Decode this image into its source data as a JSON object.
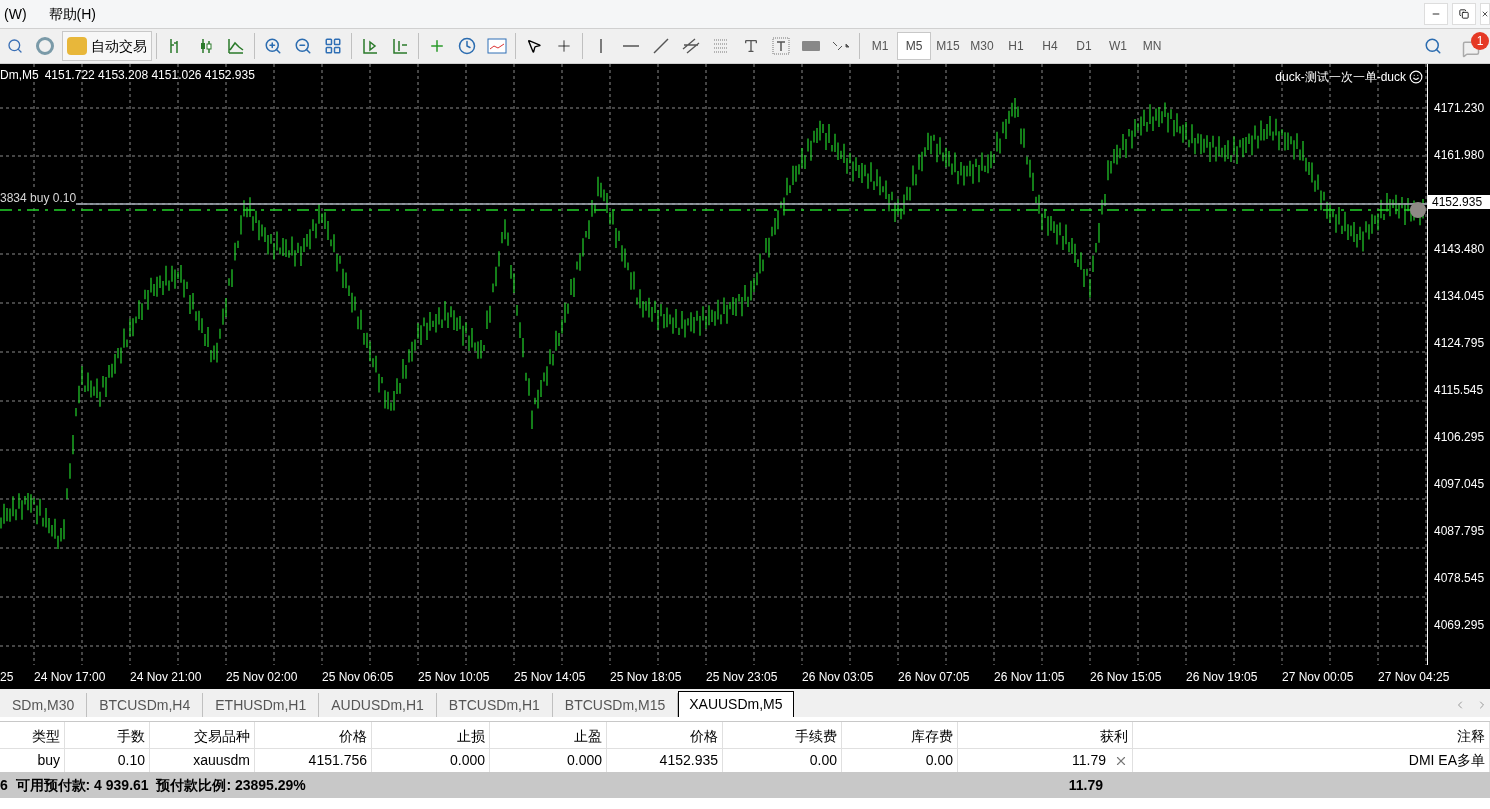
{
  "menu": [
    {
      "label": "(W)"
    },
    {
      "label": "帮助(H)"
    }
  ],
  "toolbar": {
    "auto_trading": "自动交易",
    "timeframes": [
      {
        "label": "M1",
        "selected": false
      },
      {
        "label": "M5",
        "selected": true
      },
      {
        "label": "M15",
        "selected": false
      },
      {
        "label": "M30",
        "selected": false
      },
      {
        "label": "H1",
        "selected": false
      },
      {
        "label": "H4",
        "selected": false
      },
      {
        "label": "D1",
        "selected": false
      },
      {
        "label": "W1",
        "selected": false
      },
      {
        "label": "MN",
        "selected": false
      }
    ],
    "notification_count": "1"
  },
  "chart": {
    "header_symbol": "Dm,M5",
    "header_prices": "4151.722 4153.208 4151.026 4152.935",
    "expert": "duck-测试一次一单-duck",
    "order_label": "3834 buy 0.10",
    "price_labels": [
      {
        "text": "4171.230",
        "kind": "tick"
      },
      {
        "text": "4161.980",
        "kind": "tick"
      },
      {
        "text": "4152.935",
        "kind": "current"
      },
      {
        "text": "4143.480",
        "kind": "tick"
      },
      {
        "text": "4134.045",
        "kind": "tick"
      },
      {
        "text": "4124.795",
        "kind": "tick"
      },
      {
        "text": "4115.545",
        "kind": "tick"
      },
      {
        "text": "4106.295",
        "kind": "tick"
      },
      {
        "text": "4097.045",
        "kind": "tick"
      },
      {
        "text": "4087.795",
        "kind": "tick"
      },
      {
        "text": "4078.545",
        "kind": "tick"
      },
      {
        "text": "4069.295",
        "kind": "tick"
      }
    ],
    "time_labels": [
      "25",
      "24 Nov 17:00",
      "24 Nov 21:00",
      "25 Nov 02:00",
      "25 Nov 06:05",
      "25 Nov 10:05",
      "25 Nov 14:05",
      "25 Nov 18:05",
      "25 Nov 23:05",
      "26 Nov 03:05",
      "26 Nov 07:05",
      "26 Nov 11:05",
      "26 Nov 15:05",
      "26 Nov 19:05",
      "27 Nov 00:05",
      "27 Nov 04:25"
    ]
  },
  "chart_tabs": [
    {
      "label": "SDm,M30",
      "selected": false
    },
    {
      "label": "BTCUSDm,H4",
      "selected": false
    },
    {
      "label": "ETHUSDm,H1",
      "selected": false
    },
    {
      "label": "AUDUSDm,H1",
      "selected": false
    },
    {
      "label": "BTCUSDm,H1",
      "selected": false
    },
    {
      "label": "BTCUSDm,M15",
      "selected": false
    },
    {
      "label": "XAUUSDm,M5",
      "selected": true
    }
  ],
  "trade_table": {
    "columns": [
      {
        "label": "类型",
        "kind": "text"
      },
      {
        "label": "手数",
        "kind": "text"
      },
      {
        "label": "交易品种",
        "kind": "text"
      },
      {
        "label": "价格",
        "kind": "text"
      },
      {
        "label": "止损",
        "kind": "text"
      },
      {
        "label": "止盈",
        "kind": "text"
      },
      {
        "label": "价格",
        "kind": "text"
      },
      {
        "label": "手续费",
        "kind": "text"
      },
      {
        "label": "库存费",
        "kind": "text"
      },
      {
        "label": "获利",
        "kind": "profit"
      },
      {
        "label": "注释",
        "kind": "text"
      }
    ],
    "rows": [
      [
        "buy",
        "0.10",
        "xauusdm",
        "4151.756",
        "0.000",
        "0.000",
        "4152.935",
        "0.00",
        "0.00",
        "11.79",
        "DMI EA多单"
      ]
    ],
    "summary": {
      "account": "6  可用预付款: 4 939.61  预付款比例: 23895.29%",
      "profit": "11.79"
    }
  }
}
